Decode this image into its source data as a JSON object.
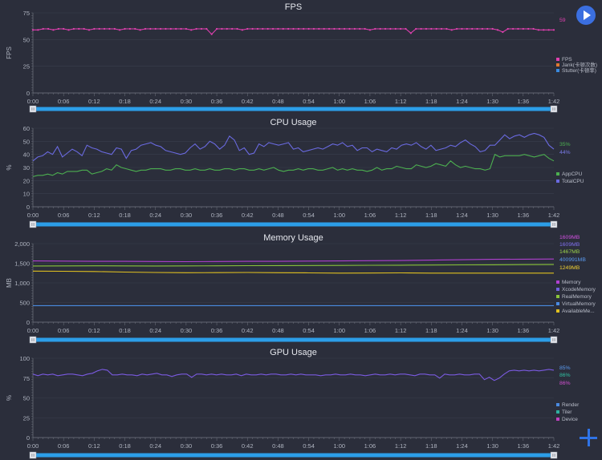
{
  "chart_data": [
    {
      "type": "line",
      "title": "FPS",
      "ylabel": "FPS",
      "ylim": [
        0,
        75
      ],
      "yticks": [
        "0",
        "25",
        "50",
        "75"
      ],
      "x_ticks": [
        "0:00",
        "0:06",
        "0:12",
        "0:18",
        "0:24",
        "0:30",
        "0:36",
        "0:42",
        "0:48",
        "0:54",
        "1:00",
        "1:06",
        "1:12",
        "1:18",
        "1:24",
        "1:30",
        "1:36",
        "1:42"
      ],
      "legend": [
        {
          "label": "FPS",
          "color": "#e040b0"
        },
        {
          "label": "Jank(卡顿次数)",
          "color": "#e07830"
        },
        {
          "label": "Stutter(卡顿率)",
          "color": "#3a8ae0"
        }
      ],
      "last_values": [
        {
          "text": "59",
          "color": "#e040b0"
        }
      ],
      "series": [
        {
          "name": "FPS",
          "color": "#e040b0",
          "markers": true,
          "values": [
            59,
            59,
            60,
            60,
            59,
            60,
            60,
            59,
            60,
            60,
            60,
            59,
            60,
            60,
            60,
            60,
            60,
            59,
            60,
            60,
            60,
            59,
            60,
            60,
            60,
            60,
            60,
            60,
            60,
            60,
            60,
            59,
            60,
            60,
            60,
            55,
            60,
            60,
            60,
            60,
            60,
            59,
            60,
            60,
            60,
            60,
            60,
            60,
            60,
            60,
            60,
            60,
            60,
            60,
            60,
            60,
            60,
            60,
            60,
            60,
            60,
            60,
            60,
            60,
            60,
            60,
            59,
            60,
            60,
            60,
            60,
            60,
            60,
            60,
            56,
            60,
            60,
            60,
            60,
            60,
            60,
            60,
            59,
            60,
            60,
            60,
            60,
            60,
            60,
            60,
            60,
            59,
            57,
            60,
            60,
            60,
            60,
            60,
            60,
            59,
            59,
            59,
            59
          ]
        }
      ]
    },
    {
      "type": "line",
      "title": "CPU Usage",
      "ylabel": "%",
      "ylim": [
        0,
        60
      ],
      "yticks": [
        "0",
        "10",
        "20",
        "30",
        "40",
        "50",
        "60"
      ],
      "x_ticks": [
        "0:00",
        "0:06",
        "0:12",
        "0:18",
        "0:24",
        "0:30",
        "0:36",
        "0:42",
        "0:48",
        "0:54",
        "1:00",
        "1:06",
        "1:12",
        "1:18",
        "1:24",
        "1:30",
        "1:36",
        "1:42"
      ],
      "legend": [
        {
          "label": "AppCPU",
          "color": "#4caf50"
        },
        {
          "label": "TotalCPU",
          "color": "#6a6ae0"
        }
      ],
      "last_values": [
        {
          "text": "35%",
          "color": "#4caf50"
        },
        {
          "text": "44%",
          "color": "#7a7ae8"
        }
      ],
      "series": [
        {
          "name": "TotalCPU",
          "color": "#6a6ae0",
          "values": [
            35,
            38,
            39,
            42,
            40,
            46,
            38,
            41,
            44,
            42,
            39,
            47,
            45,
            44,
            42,
            41,
            40,
            45,
            44,
            37,
            43,
            44,
            47,
            48,
            49,
            47,
            46,
            43,
            42,
            41,
            40,
            41,
            45,
            48,
            44,
            46,
            50,
            48,
            44,
            47,
            54,
            51,
            43,
            45,
            40,
            41,
            48,
            46,
            49,
            48,
            47,
            48,
            49,
            44,
            45,
            42,
            43,
            44,
            45,
            44,
            46,
            48,
            47,
            49,
            46,
            47,
            43,
            45,
            45,
            42,
            44,
            43,
            42,
            45,
            44,
            47,
            48,
            47,
            49,
            46,
            44,
            47,
            43,
            44,
            45,
            47,
            46,
            49,
            51,
            48,
            46,
            42,
            43,
            47,
            47,
            51,
            55,
            52,
            54,
            55,
            53,
            55,
            56,
            55,
            53,
            47,
            44
          ]
        },
        {
          "name": "AppCPU",
          "color": "#4caf50",
          "values": [
            23,
            24,
            24,
            25,
            24,
            26,
            25,
            27,
            27,
            27,
            28,
            28,
            25,
            26,
            27,
            29,
            28,
            32,
            30,
            29,
            28,
            27,
            28,
            28,
            29,
            29,
            29,
            28,
            28,
            29,
            29,
            28,
            28,
            29,
            28,
            28,
            29,
            28,
            28,
            29,
            29,
            28,
            29,
            29,
            28,
            28,
            29,
            28,
            29,
            30,
            28,
            27,
            28,
            28,
            29,
            28,
            29,
            29,
            28,
            28,
            29,
            30,
            28,
            29,
            28,
            29,
            28,
            28,
            27,
            28,
            30,
            28,
            29,
            29,
            31,
            30,
            29,
            29,
            32,
            31,
            30,
            31,
            33,
            32,
            31,
            35,
            32,
            30,
            31,
            30,
            29,
            29,
            28,
            29,
            40,
            38,
            39,
            39,
            39,
            39,
            40,
            39,
            38,
            39,
            40,
            37,
            35
          ]
        }
      ]
    },
    {
      "type": "line",
      "title": "Memory Usage",
      "ylabel": "MB",
      "ylim": [
        0,
        2000
      ],
      "yticks": [
        "0",
        "500",
        "1,000",
        "1,500",
        "2,000"
      ],
      "x_ticks": [
        "0:00",
        "0:06",
        "0:12",
        "0:18",
        "0:24",
        "0:30",
        "0:36",
        "0:42",
        "0:48",
        "0:54",
        "1:00",
        "1:06",
        "1:12",
        "1:18",
        "1:24",
        "1:30",
        "1:36",
        "1:42"
      ],
      "legend": [
        {
          "label": "Memory",
          "color": "#b040d0"
        },
        {
          "label": "XcodeMemory",
          "color": "#7060e0"
        },
        {
          "label": "RealMemory",
          "color": "#8ac43a"
        },
        {
          "label": "VirtualMemory",
          "color": "#4a8ae0"
        },
        {
          "label": "AvailableMe...",
          "color": "#e0c020"
        }
      ],
      "last_values": [
        {
          "text": "1609MB",
          "color": "#d050e0"
        },
        {
          "text": "1609MB",
          "color": "#8070f0"
        },
        {
          "text": "1467MB",
          "color": "#9ad04a"
        },
        {
          "text": "400991MB",
          "color": "#5a9af0"
        },
        {
          "text": "1249MB",
          "color": "#f0d030"
        }
      ],
      "series": [
        {
          "name": "Memory",
          "color": "#b040d0",
          "values": [
            1560,
            1555,
            1550,
            1550,
            1545,
            1540,
            1545,
            1550,
            1550,
            1555,
            1560,
            1565,
            1570,
            1580,
            1590,
            1600,
            1605,
            1609
          ]
        },
        {
          "name": "RealMemory",
          "color": "#8ac43a",
          "values": [
            1430,
            1432,
            1435,
            1433,
            1430,
            1432,
            1435,
            1438,
            1440,
            1442,
            1445,
            1448,
            1450,
            1455,
            1460,
            1462,
            1465,
            1467
          ]
        },
        {
          "name": "AvailableMemory",
          "color": "#e0c020",
          "values": [
            1300,
            1295,
            1290,
            1275,
            1265,
            1260,
            1262,
            1265,
            1260,
            1255,
            1250,
            1252,
            1255,
            1250,
            1248,
            1250,
            1250,
            1249
          ]
        },
        {
          "name": "VirtualMemory",
          "color": "#4a8ae0",
          "values": [
            420,
            420,
            420,
            420,
            420,
            420,
            420,
            420,
            420,
            420,
            420,
            420,
            420,
            420,
            420,
            420,
            420,
            420
          ]
        }
      ]
    },
    {
      "type": "line",
      "title": "GPU Usage",
      "ylabel": "%",
      "ylim": [
        0,
        100
      ],
      "yticks": [
        "0",
        "25",
        "50",
        "75",
        "100"
      ],
      "x_ticks": [
        "0:00",
        "0:06",
        "0:12",
        "0:18",
        "0:24",
        "0:30",
        "0:36",
        "0:42",
        "0:48",
        "0:54",
        "1:00",
        "1:06",
        "1:12",
        "1:18",
        "1:24",
        "1:30",
        "1:36",
        "1:42"
      ],
      "legend": [
        {
          "label": "Render",
          "color": "#4a8ae0"
        },
        {
          "label": "Tiler",
          "color": "#30b0a0"
        },
        {
          "label": "Device",
          "color": "#c040c0"
        }
      ],
      "last_values": [
        {
          "text": "85%",
          "color": "#5a9af0"
        },
        {
          "text": "86%",
          "color": "#30c0a0"
        },
        {
          "text": "86%",
          "color": "#d050d0"
        }
      ],
      "series": [
        {
          "name": "Device",
          "color": "#7a5ae0",
          "values": [
            80,
            78,
            80,
            79,
            80,
            78,
            79,
            80,
            80,
            79,
            78,
            80,
            81,
            84,
            86,
            85,
            79,
            79,
            80,
            79,
            79,
            78,
            80,
            79,
            80,
            81,
            79,
            79,
            77,
            79,
            80,
            80,
            76,
            80,
            80,
            79,
            80,
            79,
            80,
            79,
            79,
            80,
            78,
            80,
            79,
            79,
            80,
            79,
            80,
            80,
            79,
            79,
            80,
            79,
            80,
            79,
            79,
            79,
            78,
            79,
            79,
            80,
            79,
            79,
            80,
            79,
            79,
            78,
            79,
            80,
            79,
            79,
            80,
            79,
            80,
            80,
            79,
            78,
            80,
            80,
            79,
            79,
            75,
            80,
            79,
            79,
            80,
            79,
            79,
            80,
            80,
            73,
            76,
            72,
            75,
            80,
            84,
            85,
            84,
            85,
            84,
            85,
            84,
            85,
            86,
            85
          ]
        }
      ]
    }
  ]
}
